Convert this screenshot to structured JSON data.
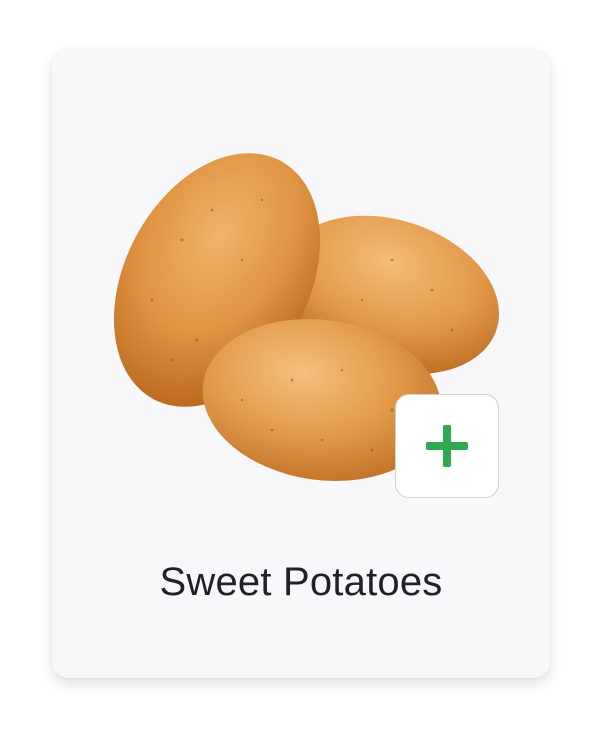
{
  "product": {
    "name": "Sweet Potatoes",
    "image_icon": "potatoes-image",
    "add_icon": "plus-icon"
  },
  "colors": {
    "card_background": "#f8f8fa",
    "accent_green": "#2fa84f",
    "text": "#1f2328"
  }
}
